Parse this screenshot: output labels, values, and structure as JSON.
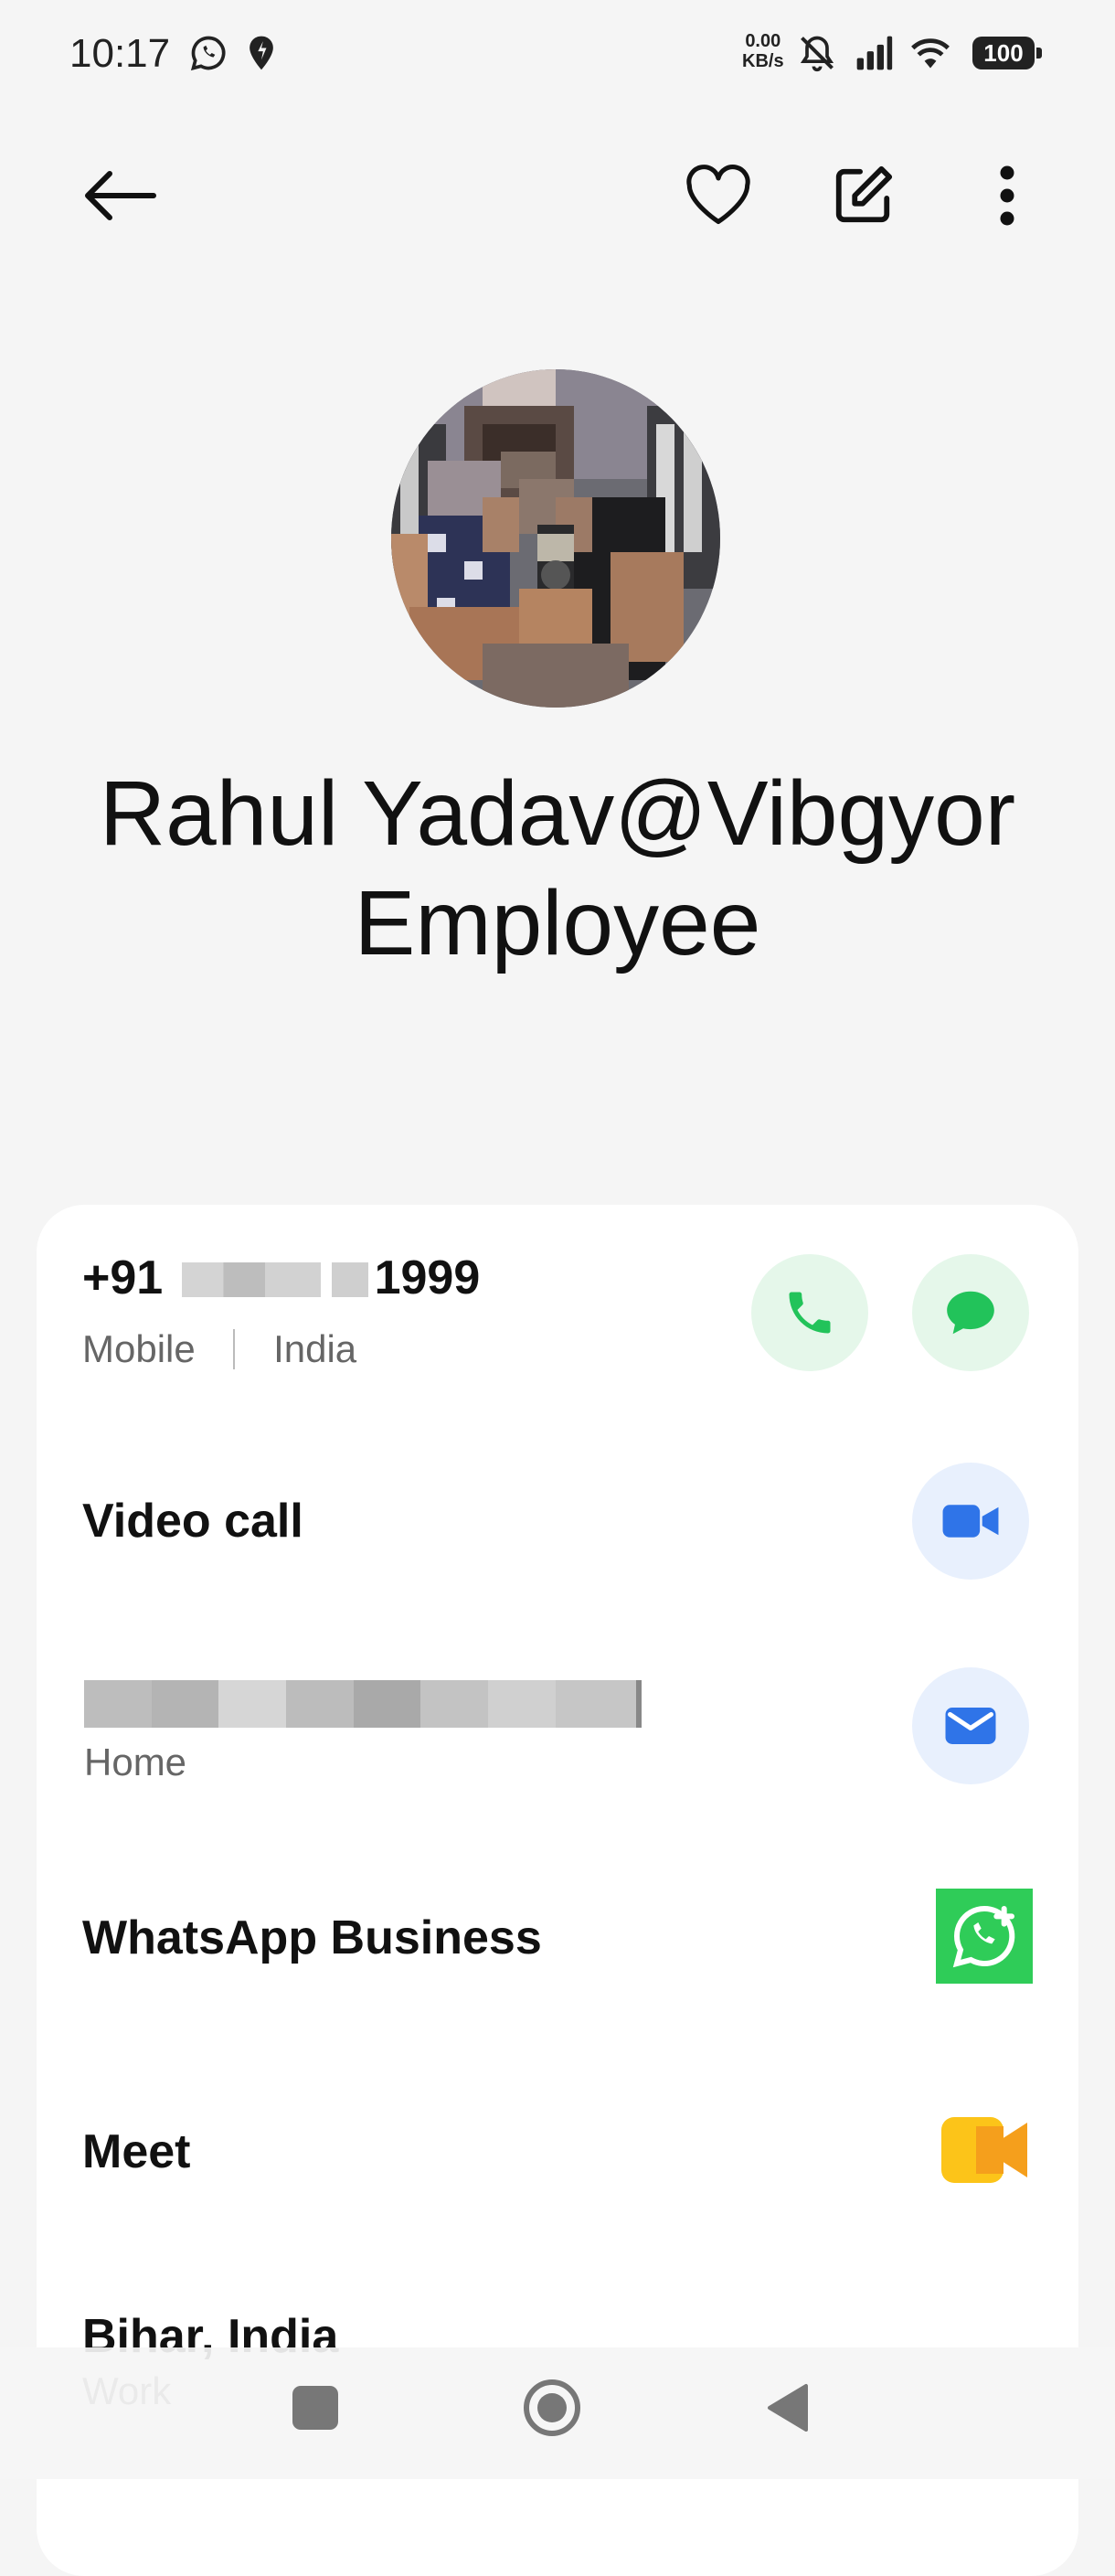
{
  "status_bar": {
    "time": "10:17",
    "net_speed_value": "0.00",
    "net_speed_unit": "KB/s",
    "battery": "100",
    "icons": [
      "whatsapp-notification-icon",
      "location-icon",
      "mute-icon",
      "signal-icon",
      "wifi-icon",
      "battery-icon"
    ]
  },
  "toolbar": {
    "icons": [
      "back-arrow-icon",
      "favorite-heart-icon",
      "edit-icon",
      "more-vert-icon"
    ]
  },
  "contact": {
    "name_line1": "Rahul Yadav@Vibgyor",
    "name_line2": "Employee"
  },
  "phone": {
    "prefix": "+91",
    "suffix": "1999",
    "type": "Mobile",
    "country": "India"
  },
  "video_call": {
    "label": "Video call"
  },
  "email": {
    "type": "Home"
  },
  "whatsapp": {
    "label": "WhatsApp Business"
  },
  "meet": {
    "label": "Meet"
  },
  "address": {
    "value": "Bihar, India",
    "type": "Work"
  },
  "colors": {
    "green_accent": "#22c35a",
    "blue_accent": "#2f74e8",
    "whatsapp_bg": "#2fcc58",
    "meet_yellow": "#fcc419",
    "meet_orange": "#f59f1c"
  },
  "nav": {
    "icons": [
      "recents-square-icon",
      "home-circle-icon",
      "back-triangle-icon"
    ]
  }
}
